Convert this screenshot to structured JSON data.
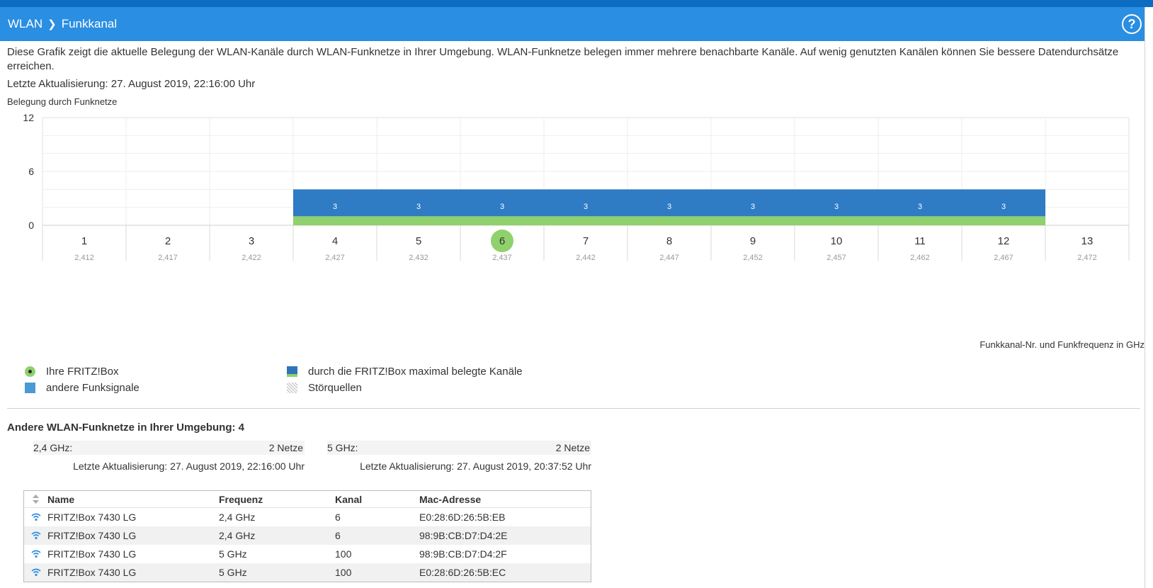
{
  "header": {
    "crumb_parent": "WLAN",
    "crumb_current": "Funkkanal",
    "help_label": "?"
  },
  "description": "Diese Grafik zeigt die aktuelle Belegung der WLAN-Kanäle durch WLAN-Funknetze in Ihrer Umgebung. WLAN-Funknetze belegen immer mehrere benachbarte Kanäle. Auf wenig genutzten Kanälen können Sie bessere Datendurchsätze erreichen.",
  "last_update": "Letzte Aktualisierung: 27. August 2019, 22:16:00 Uhr",
  "chart_data": {
    "type": "bar",
    "ylabel": "Belegung durch Funknetze",
    "xlabel": "Funkkanal-Nr. und Funkfrequenz in GHz",
    "ylim": [
      0,
      12
    ],
    "yticks": [
      0,
      6,
      12
    ],
    "grid": true,
    "categories": [
      "1",
      "2",
      "3",
      "4",
      "5",
      "6",
      "7",
      "8",
      "9",
      "10",
      "11",
      "12",
      "13"
    ],
    "frequencies": [
      "2,412",
      "2,417",
      "2,422",
      "2,427",
      "2,432",
      "2,437",
      "2,442",
      "2,447",
      "2,452",
      "2,457",
      "2,462",
      "2,467",
      "2,472"
    ],
    "series": [
      {
        "name": "andere Funksignale",
        "values": [
          0,
          0,
          0,
          3,
          3,
          3,
          3,
          3,
          3,
          3,
          3,
          3,
          0
        ],
        "color": "#2f7bc4"
      },
      {
        "name": "durch die FRITZ!Box maximal belegte Kanäle",
        "values": [
          0,
          0,
          0,
          1,
          1,
          1,
          1,
          1,
          1,
          1,
          1,
          1,
          0
        ],
        "color": "#8fd16c"
      }
    ],
    "bar_labels": [
      "",
      "",
      "",
      "3",
      "3",
      "3",
      "3",
      "3",
      "3",
      "3",
      "3",
      "3",
      ""
    ],
    "fritzbox_channel": "6"
  },
  "legend": {
    "fritzbox": "Ihre FRITZ!Box",
    "other": "andere Funksignale",
    "max": "durch die FRITZ!Box maximal belegte Kanäle",
    "noise": "Störquellen"
  },
  "others": {
    "title": "Andere WLAN-Funknetze in Ihrer Umgebung: 4",
    "band24": {
      "label": "2,4 GHz:",
      "count": "2 Netze",
      "updated": "Letzte Aktualisierung: 27. August 2019, 22:16:00 Uhr"
    },
    "band5": {
      "label": "5 GHz:",
      "count": "2 Netze",
      "updated": "Letzte Aktualisierung: 27. August 2019, 20:37:52 Uhr"
    }
  },
  "table": {
    "headers": {
      "name": "Name",
      "freq": "Frequenz",
      "chan": "Kanal",
      "mac": "Mac-Adresse"
    },
    "rows": [
      {
        "name": "FRITZ!Box 7430 LG",
        "freq": "2,4 GHz",
        "chan": "6",
        "mac": "E0:28:6D:26:5B:EB"
      },
      {
        "name": "FRITZ!Box 7430 LG",
        "freq": "2,4 GHz",
        "chan": "6",
        "mac": "98:9B:CB:D7:D4:2E"
      },
      {
        "name": "FRITZ!Box 7430 LG",
        "freq": "5 GHz",
        "chan": "100",
        "mac": "98:9B:CB:D7:D4:2F"
      },
      {
        "name": "FRITZ!Box 7430 LG",
        "freq": "5 GHz",
        "chan": "100",
        "mac": "E0:28:6D:26:5B:EC"
      }
    ]
  },
  "colors": {
    "header_bg": "#2a8ee2",
    "top_strip": "#0b6cc2",
    "other_signals": "#2f7bc4",
    "fritzbox_green": "#8fd16c",
    "wifi_icon": "#2a8ee2"
  },
  "icons": {
    "help": "question-circle-icon",
    "sort": "sort-arrows-icon",
    "wifi": "wifi-icon"
  }
}
